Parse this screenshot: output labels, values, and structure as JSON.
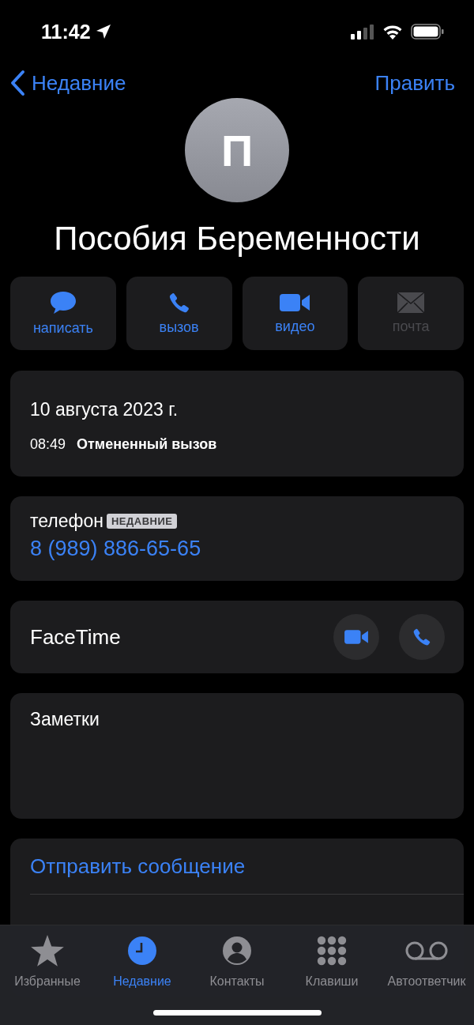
{
  "status_bar": {
    "time": "11:42"
  },
  "nav": {
    "back": "Недавние",
    "edit": "Править"
  },
  "contact": {
    "initial": "П",
    "name": "Пособия Беременности"
  },
  "actions": [
    {
      "kind": "message",
      "label": "написать",
      "disabled": false
    },
    {
      "kind": "call",
      "label": "вызов",
      "disabled": false
    },
    {
      "kind": "video",
      "label": "видео",
      "disabled": false
    },
    {
      "kind": "mail",
      "label": "почта",
      "disabled": true
    }
  ],
  "call_info": {
    "date": "10 августа 2023 г.",
    "time": "08:49",
    "status": "Отмененный вызов"
  },
  "phone": {
    "label": "телефон",
    "badge": "НЕДАВНИЕ",
    "number": "8 (989) 886-65-65"
  },
  "facetime": {
    "label": "FaceTime"
  },
  "notes": {
    "label": "Заметки"
  },
  "links": [
    {
      "label": "Отправить сообщение"
    }
  ],
  "tabs": [
    {
      "kind": "favorites",
      "label": "Избранные",
      "selected": false
    },
    {
      "kind": "recents",
      "label": "Недавние",
      "selected": true
    },
    {
      "kind": "contacts",
      "label": "Контакты",
      "selected": false
    },
    {
      "kind": "keypad",
      "label": "Клавиши",
      "selected": false
    },
    {
      "kind": "voicemail",
      "label": "Автоответчик",
      "selected": false
    }
  ]
}
